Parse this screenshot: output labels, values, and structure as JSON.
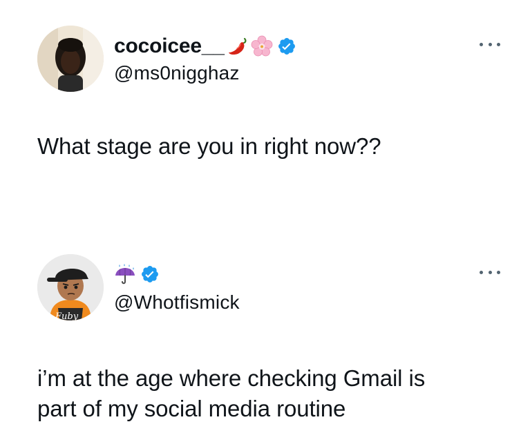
{
  "tweets": [
    {
      "display_name": "cocoicee__",
      "name_emojis": [
        "hot-pepper-emoji",
        "cherry-blossom-emoji"
      ],
      "verified": true,
      "handle": "@ms0nigghaz",
      "text": "What stage are you in right now??",
      "more_icon": "more-horizontal-icon"
    },
    {
      "display_name": "",
      "name_emojis": [
        "umbrella-with-rain-emoji"
      ],
      "verified": true,
      "handle": "@Whotfismick",
      "text": "i’m at the age where checking Gmail is\npart of my social media routine",
      "more_icon": "more-horizontal-icon"
    }
  ],
  "colors": {
    "text": "#0f1419",
    "verified_badge": "#1d9bf0",
    "more_dots": "#536471"
  }
}
